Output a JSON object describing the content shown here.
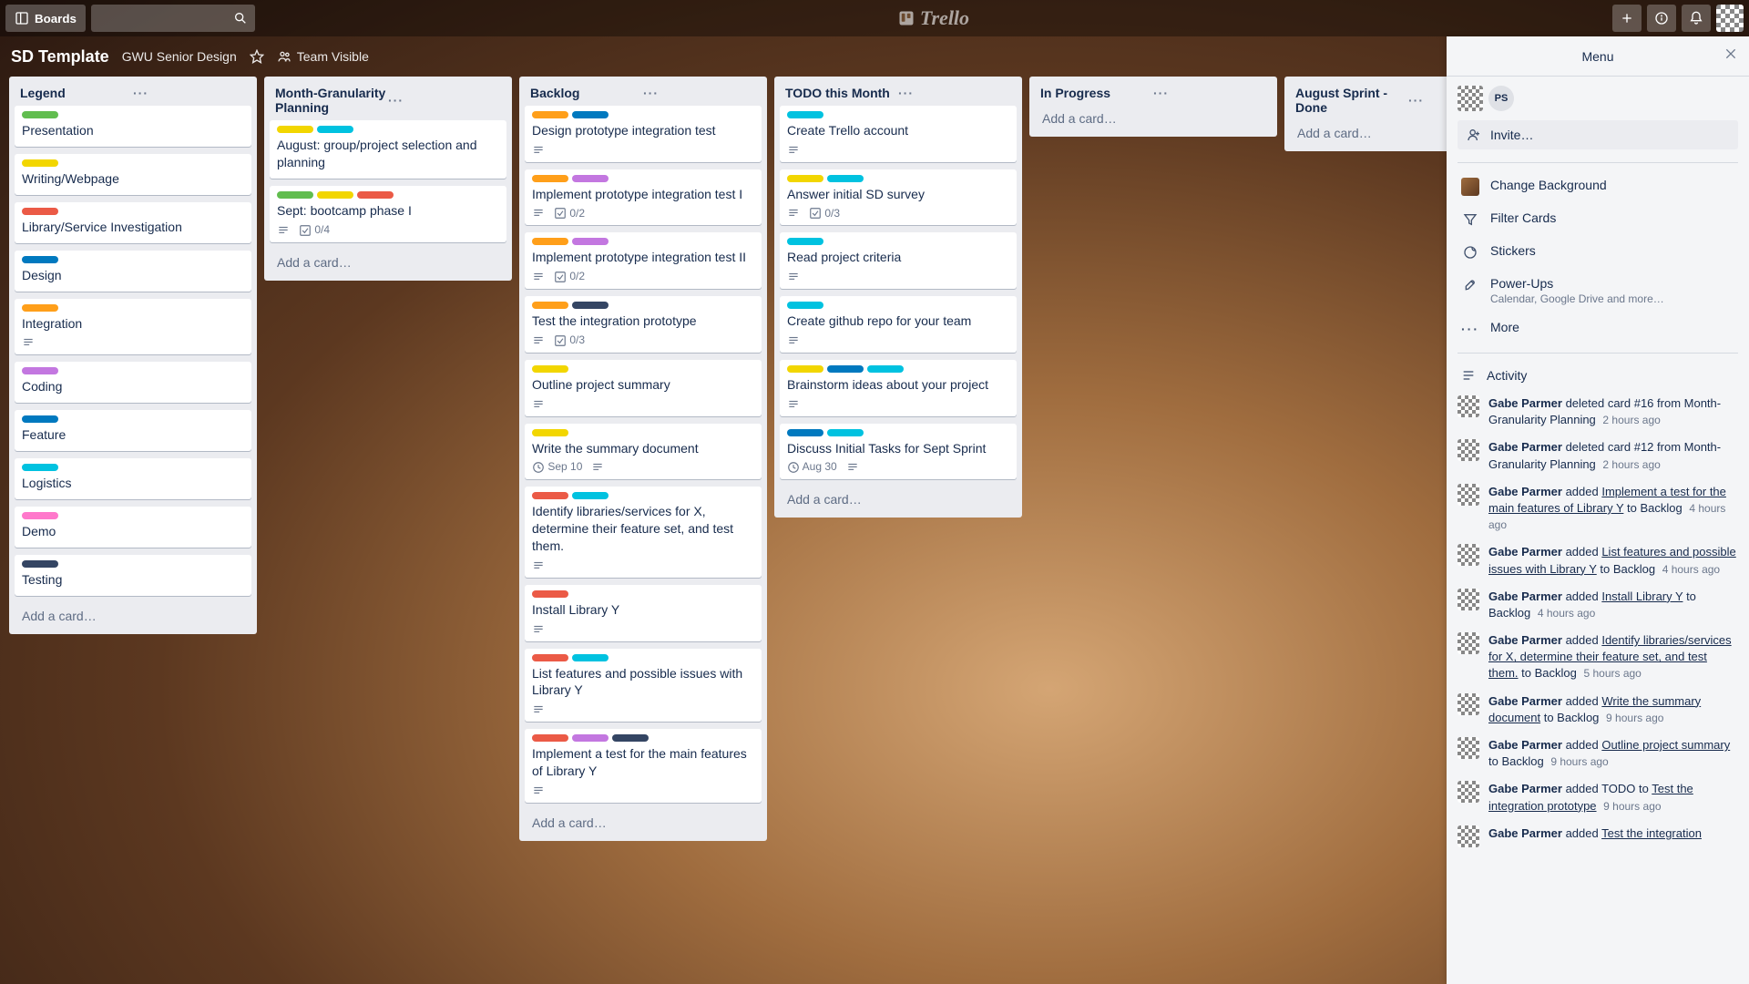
{
  "header": {
    "boards_label": "Boards",
    "logo_text": "Trello"
  },
  "board": {
    "name": "SD Template",
    "subtitle": "GWU Senior Design",
    "visibility": "Team Visible"
  },
  "labelColors": {
    "green": "#61bd4f",
    "yellow": "#f2d600",
    "red": "#eb5a46",
    "blue": "#0079bf",
    "orange": "#ff9f1a",
    "sky": "#00c2e0",
    "purple": "#c377e0",
    "pink": "#ff78cb",
    "black": "#344563"
  },
  "lists": [
    {
      "title": "Legend",
      "cards": [
        {
          "labels": [
            "green"
          ],
          "title": "Presentation"
        },
        {
          "labels": [
            "yellow"
          ],
          "title": "Writing/Webpage"
        },
        {
          "labels": [
            "red"
          ],
          "title": "Library/Service Investigation"
        },
        {
          "labels": [
            "blue"
          ],
          "title": "Design"
        },
        {
          "labels": [
            "orange"
          ],
          "title": "Integration",
          "desc": true
        },
        {
          "labels": [
            "purple"
          ],
          "title": "Coding"
        },
        {
          "labels": [
            "blue"
          ],
          "title": "Feature"
        },
        {
          "labels": [
            "sky"
          ],
          "title": "Logistics"
        },
        {
          "labels": [
            "pink"
          ],
          "title": "Demo"
        },
        {
          "labels": [
            "black"
          ],
          "title": "Testing"
        }
      ],
      "add": "Add a card…"
    },
    {
      "title": "Month-Granularity Planning",
      "cards": [
        {
          "labels": [
            "yellow",
            "sky"
          ],
          "title": "August: group/project selection and planning"
        },
        {
          "labels": [
            "green",
            "yellow",
            "red"
          ],
          "title": "Sept: bootcamp phase I",
          "desc": true,
          "check": "0/4"
        }
      ],
      "add": "Add a card…"
    },
    {
      "title": "Backlog",
      "cards": [
        {
          "labels": [
            "orange",
            "blue"
          ],
          "title": "Design prototype integration test",
          "desc": true
        },
        {
          "labels": [
            "orange",
            "purple"
          ],
          "title": "Implement prototype integration test I",
          "desc": true,
          "check": "0/2"
        },
        {
          "labels": [
            "orange",
            "purple"
          ],
          "title": "Implement prototype integration test II",
          "desc": true,
          "check": "0/2"
        },
        {
          "labels": [
            "orange",
            "black"
          ],
          "title": "Test the integration prototype",
          "desc": true,
          "check": "0/3"
        },
        {
          "labels": [
            "yellow"
          ],
          "title": "Outline project summary",
          "desc": true
        },
        {
          "labels": [
            "yellow"
          ],
          "title": "Write the summary document",
          "due": "Sep 10",
          "desc": true
        },
        {
          "labels": [
            "red",
            "sky"
          ],
          "title": "Identify libraries/services for X, determine their feature set, and test them.",
          "desc": true
        },
        {
          "labels": [
            "red"
          ],
          "title": "Install Library Y",
          "desc": true
        },
        {
          "labels": [
            "red",
            "sky"
          ],
          "title": "List features and possible issues with Library Y",
          "desc": true
        },
        {
          "labels": [
            "red",
            "purple",
            "black"
          ],
          "title": "Implement a test for the main features of Library Y",
          "desc": true
        }
      ],
      "add": "Add a card…"
    },
    {
      "title": "TODO this Month",
      "cards": [
        {
          "labels": [
            "sky"
          ],
          "title": "Create Trello account",
          "desc": true
        },
        {
          "labels": [
            "yellow",
            "sky"
          ],
          "title": "Answer initial SD survey",
          "desc": true,
          "check": "0/3"
        },
        {
          "labels": [
            "sky"
          ],
          "title": "Read project criteria",
          "desc": true
        },
        {
          "labels": [
            "sky"
          ],
          "title": "Create github repo for your team",
          "desc": true
        },
        {
          "labels": [
            "yellow",
            "blue",
            "sky"
          ],
          "title": "Brainstorm ideas about your project",
          "desc": true
        },
        {
          "labels": [
            "blue",
            "sky"
          ],
          "title": "Discuss Initial Tasks for Sept Sprint",
          "due": "Aug 30",
          "desc": true
        }
      ],
      "add": "Add a card…"
    },
    {
      "title": "In Progress",
      "cards": [],
      "add": "Add a card…"
    },
    {
      "title": "August Sprint - Done",
      "cards": [],
      "add": "Add a card…"
    }
  ],
  "menu": {
    "title": "Menu",
    "member_initials": "PS",
    "invite": "Invite…",
    "items": {
      "background": "Change Background",
      "filter": "Filter Cards",
      "stickers": "Stickers",
      "powerups": "Power-Ups",
      "powerups_sub": "Calendar, Google Drive and more…",
      "more": "More",
      "activity": "Activity"
    },
    "actor": "Gabe Parmer",
    "activity": [
      {
        "text_before": "deleted card #16 from Month-Granularity Planning",
        "time": "2 hours ago"
      },
      {
        "text_before": "deleted card #12 from Month-Granularity Planning",
        "time": "2 hours ago"
      },
      {
        "text_before": "added ",
        "link": "Implement a test for the main features of Library Y",
        "text_after": " to Backlog",
        "time": "4 hours ago"
      },
      {
        "text_before": "added ",
        "link": "List features and possible issues with Library Y",
        "text_after": " to Backlog",
        "time": "4 hours ago"
      },
      {
        "text_before": "added ",
        "link": "Install Library Y",
        "text_after": " to Backlog",
        "time": "4 hours ago"
      },
      {
        "text_before": "added ",
        "link": "Identify libraries/services for X, determine their feature set, and test them.",
        "text_after": " to Backlog",
        "time": "5 hours ago"
      },
      {
        "text_before": "added ",
        "link": "Write the summary document",
        "text_after": " to Backlog",
        "time": "9 hours ago"
      },
      {
        "text_before": "added ",
        "link": "Outline project summary",
        "text_after": " to Backlog",
        "time": "9 hours ago"
      },
      {
        "text_before": "added TODO to ",
        "link": "Test the integration prototype",
        "time": "9 hours ago"
      },
      {
        "text_before": "added ",
        "link": "Test the integration",
        "time": ""
      }
    ]
  }
}
